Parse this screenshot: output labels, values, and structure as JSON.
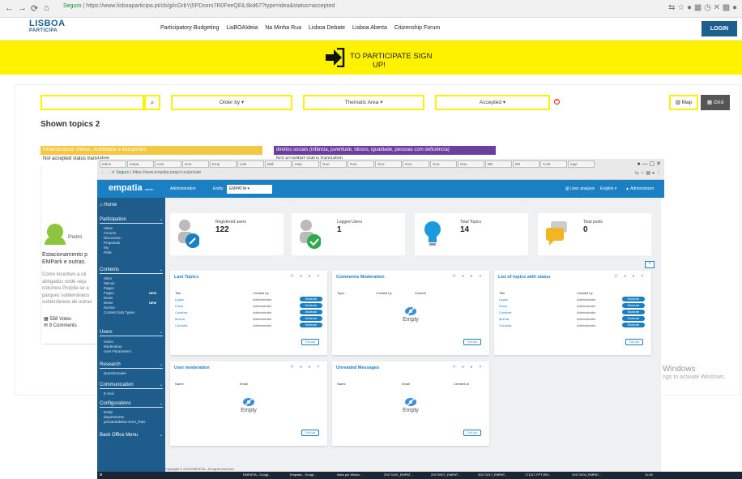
{
  "browser1": {
    "nav": [
      "←",
      "→",
      "⟳",
      "⌂"
    ],
    "secure": "Seguro",
    "url": "https://www.lisboaparticipa.pt/cb/gi/cGrbYj5PDoxrs7R0FeeQEiL6kd67?type=idea&status=accepted",
    "ext_icons": "⇆ ☆ ● ▦ ◷ ✕ ▩ ●"
  },
  "site": {
    "logo": {
      "line1": "LISBOA",
      "line2": "PARTICIPA"
    },
    "nav": [
      "Participatory Budgeting",
      "LisBOAIdeia",
      "Na Minha Rua",
      "Lisboa Debate",
      "Lisboa Aberta",
      "Citizenship Forum"
    ],
    "login": "LOGIN",
    "banner": {
      "line1": "TO PARTICIPATE SIGN",
      "line2": "UP!"
    },
    "filters": {
      "search_placeholder": "",
      "search_icon": "search-icon",
      "order": "Order by ▾",
      "area": "Thematic Area ▾",
      "status": "Accepted ▾",
      "clear": "×",
      "map": "Map",
      "grid": "Grid"
    },
    "shown": "Shown topics 2",
    "cards": [
      {
        "category": "Infraestruturas Viárias, mobilidade e transportes",
        "status": "Not accepted status translation",
        "color": "#f4c842"
      },
      {
        "category": "direitos sociais (infância, juventude, idosos, igualdade, pessoas com deficiência)",
        "status": "Not accepted status translation",
        "color": "#6b3fa0"
      }
    ],
    "author": "Pedro",
    "excerpt": "Estacionamento p EMPark e outras.",
    "excerpt2": "Como incentivo a uti abrigados onde seja noturnos Propõe-se a parques subterrâneos subterrâneos de outras",
    "votes": "558 Votes",
    "comments": "8 Comments",
    "windows1": "Windows",
    "windows2": "ngs to activate Windows."
  },
  "browser2": {
    "tabs": [
      "Inbox",
      "empa",
      "com",
      "Goo",
      "Emp",
      "Lisb",
      "Ball",
      "emp",
      "Goo",
      "Goo",
      "Goo",
      "Goo",
      "Goo",
      "Goo",
      "ER",
      "ER",
      "Cont",
      "logo"
    ],
    "winctl": "●  —  ▢  ✕",
    "secure": "Seguro",
    "url": "https://www.empatia-project.eu/private",
    "ext": "⇆ ☆ ▦ ● ⋮"
  },
  "empatia": {
    "logo": "empatia",
    "logo_sub": "admin",
    "menu_admin": "Administration",
    "entity_label": "Entity",
    "entity_value": "EMPATIA",
    "user_analysis": "User analysis",
    "language": "English ▾",
    "admin_user": "Administrator",
    "sidebar": {
      "home": "Home",
      "participation": {
        "title": "Participation",
        "items": [
          "Ideas",
          "Forums",
          "Discussion",
          "Proposals",
          "My",
          "Polls"
        ]
      },
      "contents": {
        "title": "Contents",
        "items": [
          "Sites",
          "Menus",
          "Pages",
          "Pages",
          "News",
          "News",
          "Events",
          "Content Sub Types"
        ],
        "new": "NEW"
      },
      "users": {
        "title": "Users",
        "items": [
          "Users",
          "Moderation",
          "User Parameters"
        ]
      },
      "research": {
        "title": "Research",
        "items": [
          "Questionnaire"
        ]
      },
      "communication": {
        "title": "Communication",
        "items": [
          "E-mail"
        ]
      },
      "configurations": {
        "title": "Configurations",
        "items": [
          "Entity",
          "departments",
          "privateSidebar.short_links"
        ]
      },
      "backoffice": "Back Office Menu"
    },
    "stats": [
      {
        "label": "Registered users",
        "value": "122",
        "icon": "user-wrench-icon",
        "color": "#1b7fc4"
      },
      {
        "label": "Logged Users",
        "value": "1",
        "icon": "user-check-icon",
        "color": "#2eaa4a"
      },
      {
        "label": "Total Topics",
        "value": "14",
        "icon": "lightbulb-icon",
        "color": "#1b9ae0"
      },
      {
        "label": "Total posts",
        "value": "0",
        "icon": "comments-icon",
        "color": "#f2b624"
      }
    ],
    "panels": {
      "last_topics": {
        "title": "Last Topics",
        "headers": [
          "Title",
          "Created by"
        ],
        "rows": [
          {
            "title": "Lagos",
            "by": "Administrator",
            "badge": "Moderate"
          },
          {
            "title": "Faros",
            "by": "Administrator",
            "badge": "Moderate"
          },
          {
            "title": "Coimbra",
            "by": "Administrator",
            "badge": "Moderate"
          },
          {
            "title": "Murcia",
            "by": "Administrator",
            "badge": "Moderate"
          },
          {
            "title": "Cordoba",
            "by": "Administrator",
            "badge": "Moderate"
          }
        ],
        "full": "Full List"
      },
      "comments_mod": {
        "title": "Comments Moderation",
        "headers": [
          "Topic",
          "Created by",
          "Content"
        ],
        "empty": "Empty",
        "full": "Full List"
      },
      "status_topics": {
        "title": "List of topics with status",
        "headers": [
          "Title",
          "Created by"
        ],
        "rows": [
          {
            "title": "Lagos",
            "by": "Administrator",
            "badge": "Moderate"
          },
          {
            "title": "Faros",
            "by": "Administrator",
            "badge": "Moderate"
          },
          {
            "title": "Coimbra",
            "by": "Administrator",
            "badge": "Moderate"
          },
          {
            "title": "Murcia",
            "by": "Administrator",
            "badge": "Moderate"
          },
          {
            "title": "Cordoba",
            "by": "Administrator",
            "badge": "Moderate"
          }
        ],
        "full": "Full List"
      },
      "user_mod": {
        "title": "User moderation",
        "headers": [
          "Name",
          "Email"
        ],
        "empty": "Empty",
        "full": "Full List"
      },
      "unread": {
        "title": "Unreaded Messages",
        "headers": [
          "Name",
          "Email",
          "Created at"
        ],
        "empty": "Empty",
        "full": "Full List"
      }
    },
    "panel_ctl": "⟳ ● ● ✕",
    "plus": "+",
    "footer": "Copyright © 2016 EMPATIA - All rights reserved"
  },
  "taskbar": {
    "items": [
      "EMPATIA - Googl...",
      "Empatia - Googl...",
      "Ideia por Minha ...",
      "20171120_EMPAT...",
      "20170927_EMPAT...",
      "20171017_EMPAT...",
      "171117-FPT-EM...",
      "20171004_EMPAT..."
    ],
    "clock": "11:45"
  }
}
